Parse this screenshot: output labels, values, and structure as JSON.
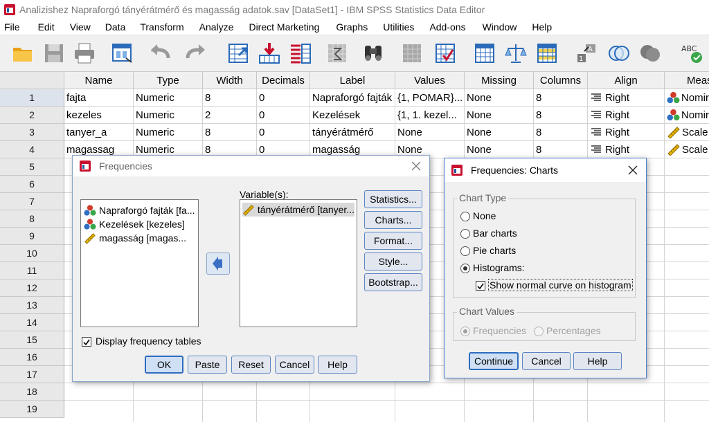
{
  "window": {
    "title": "Analizishez Napraforgó tányérátmérő és magasság adatok.sav [DataSet1] - IBM SPSS Statistics Data Editor"
  },
  "menu": [
    "File",
    "Edit",
    "View",
    "Data",
    "Transform",
    "Analyze",
    "Direct Marketing",
    "Graphs",
    "Utilities",
    "Add-ons",
    "Window",
    "Help"
  ],
  "toolbar_icons": [
    "open-icon",
    "save-icon",
    "print-icon",
    "recall-dialog-icon",
    "undo-icon",
    "redo-icon",
    "goto-case-icon",
    "goto-variable-icon",
    "variables-icon",
    "run-descriptives-icon",
    "find-icon",
    "insert-cases-icon",
    "insert-variable-icon",
    "split-file-icon",
    "weight-cases-icon",
    "select-cases-icon",
    "value-labels-icon",
    "use-sets-icon",
    "show-all-variables-icon",
    "spell-check-icon"
  ],
  "grid": {
    "columns": [
      "Name",
      "Type",
      "Width",
      "Decimals",
      "Label",
      "Values",
      "Missing",
      "Columns",
      "Align",
      "Meas"
    ],
    "rows": [
      [
        "fajta",
        "Numeric",
        "8",
        "0",
        "Napraforgó fajták",
        "{1, POMAR}...",
        "None",
        "8",
        "Right",
        "Nomir"
      ],
      [
        "kezeles",
        "Numeric",
        "2",
        "0",
        "Kezelések",
        "{1, 1. kezel...",
        "None",
        "8",
        "Right",
        "Nomir"
      ],
      [
        "tanyer_a",
        "Numeric",
        "8",
        "0",
        "tányérátmérő",
        "None",
        "None",
        "8",
        "Right",
        "Scale"
      ],
      [
        "magassag",
        "Numeric",
        "8",
        "0",
        "magasság",
        "None",
        "None",
        "8",
        "Right",
        "Scale"
      ]
    ],
    "row_numbers": [
      "1",
      "2",
      "3",
      "4",
      "5",
      "6",
      "7",
      "8",
      "9",
      "10",
      "11",
      "12",
      "13",
      "14",
      "15",
      "16",
      "17",
      "18",
      "19"
    ]
  },
  "frequencies": {
    "title": "Frequencies",
    "source_vars": [
      "Napraforgó fajták [fa...",
      "Kezelések [kezeles]",
      "magasság [magas..."
    ],
    "variables_label": "Variable(s):",
    "target_vars": [
      "tányérátmérő [tanyer..."
    ],
    "side_buttons": [
      "Statistics...",
      "Charts...",
      "Format...",
      "Style...",
      "Bootstrap..."
    ],
    "display_freq_label": "Display frequency tables",
    "display_freq_checked": true,
    "bottom_buttons": [
      "OK",
      "Paste",
      "Reset",
      "Cancel",
      "Help"
    ]
  },
  "charts": {
    "title": "Frequencies: Charts",
    "chart_type_legend": "Chart Type",
    "options": [
      "None",
      "Bar charts",
      "Pie charts",
      "Histograms:"
    ],
    "selected_option": "Histograms:",
    "normal_curve_label": "Show normal curve on histogram",
    "normal_curve_checked": true,
    "chart_values_legend": "Chart Values",
    "value_options": [
      "Frequencies",
      "Percentages"
    ],
    "buttons": [
      "Continue",
      "Cancel",
      "Help"
    ]
  },
  "colors": {
    "accent": "#2d6cc0",
    "nominal_red": "#d23a2a",
    "scale_yellow": "#e8b400"
  }
}
